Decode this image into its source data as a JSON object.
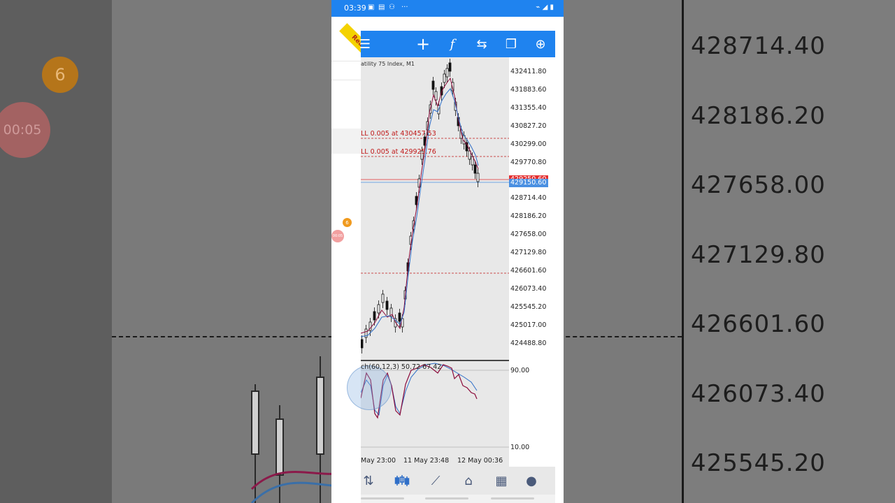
{
  "background": {
    "price_labels": [
      "428714.40",
      "428186.20",
      "427658.00",
      "427129.80",
      "426601.60",
      "426073.40",
      "425545.20"
    ],
    "badge_count": "6",
    "timer": "00:05"
  },
  "status_bar": {
    "time": "03:39",
    "icons": [
      "video-icon",
      "gallery-icon",
      "network-icon",
      "more-icon",
      "signal-icon",
      "battery-icon"
    ],
    "more": "···",
    "right_icons": "⌁ ◢ ▮"
  },
  "side_panel": {
    "account_ribbon": "Real",
    "badge_count": "6",
    "timer": "00:05"
  },
  "toolbar": {
    "menu_icon": "☰",
    "crosshair_icon": "+",
    "indicator_icon": "f",
    "objects_icon": "⇆",
    "windows_icon": "❐",
    "new_order_icon": "⊕"
  },
  "chart": {
    "symbol": "atility 75 Index, M1",
    "price_labels": [
      "432411.80",
      "431883.60",
      "431355.40",
      "430827.20",
      "430299.00",
      "429770.80",
      "428714.40",
      "428186.20",
      "427658.00",
      "427129.80",
      "426601.60",
      "426073.40",
      "425545.20",
      "425017.00",
      "424488.80"
    ],
    "ask_tag": "429250.60",
    "bid_tag": "429150.60",
    "orders": [
      {
        "label": "LL 0.005 at 430457.53"
      },
      {
        "label": "LL 0.005 at 429925.76"
      }
    ],
    "stoch_label": "ch(60,12,3) 50.72 67.42",
    "osc_levels": [
      "90.00",
      "10.00"
    ],
    "time_labels": [
      "May 23:00",
      "11 May 23:48",
      "12 May 00:36"
    ],
    "colors": {
      "accent": "#1f83ef",
      "order_line": "#c01818",
      "ma_fast": "#8b0a3a",
      "ma_slow": "#2f6fc8",
      "ask": "#e53030",
      "bid": "#4a90e2"
    }
  },
  "bottom_nav": {
    "items": [
      "quotes-icon",
      "chart-icon",
      "trade-icon",
      "history-icon",
      "news-icon",
      "messages-icon"
    ]
  }
}
